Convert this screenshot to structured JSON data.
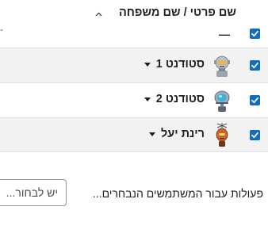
{
  "table": {
    "header": {
      "name_column": "שם פרטי / שם משפחה",
      "sort_indicator": "sort-ascending-caret",
      "dash": "—",
      "edge_dash": "-",
      "select_all_checked": true
    },
    "rows": [
      {
        "name": "סטודנט 1",
        "checked": true,
        "avatar": "robot-avatar"
      },
      {
        "name": "סטודנט 2",
        "checked": true,
        "avatar": "diver-robot-avatar"
      },
      {
        "name": "רינת יעל",
        "checked": true,
        "avatar": "antenna-robot-avatar"
      }
    ]
  },
  "bulk_actions": {
    "label": "פעולות עבור המשתמשים הנבחרים...",
    "select_value": "יש לבחור..."
  },
  "colors": {
    "checkbox": "#0f6cbf",
    "row_stripe": "#f2f2f2",
    "border": "#dee2e6",
    "text": "#1d2125"
  }
}
